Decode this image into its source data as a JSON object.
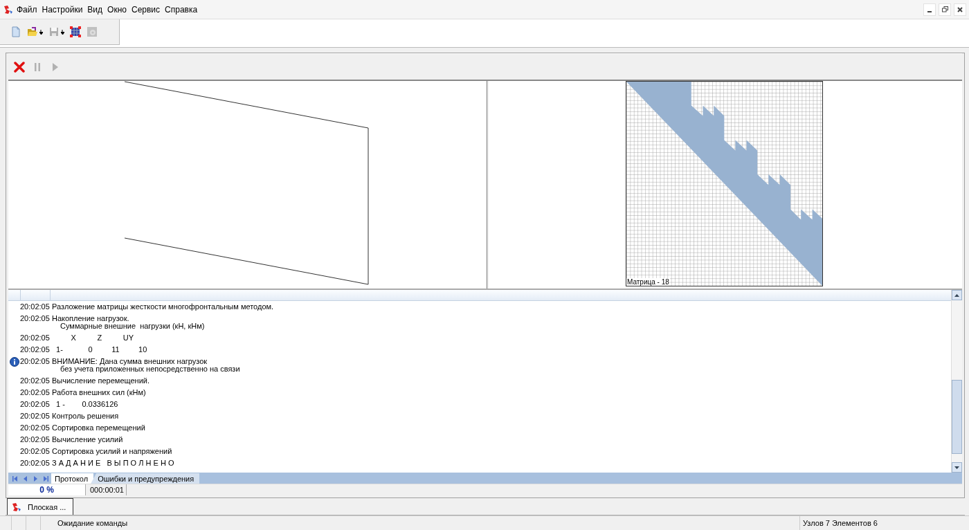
{
  "menu": [
    "Файл",
    "Настройки",
    "Вид",
    "Окно",
    "Сервис",
    "Справка"
  ],
  "toolbar": [
    {
      "kind": "new",
      "disabled": false,
      "dropdown": false
    },
    {
      "kind": "open",
      "disabled": false,
      "dropdown": true
    },
    {
      "kind": "save",
      "disabled": true,
      "dropdown": true
    },
    {
      "kind": "table",
      "disabled": false,
      "dropdown": false
    },
    {
      "kind": "settings",
      "disabled": true,
      "dropdown": false
    }
  ],
  "run_toolbar": [
    {
      "kind": "stop",
      "disabled": false
    },
    {
      "kind": "pause",
      "disabled": true
    },
    {
      "kind": "play",
      "disabled": true
    }
  ],
  "matrix": {
    "label": "Матрица - 18"
  },
  "log": [
    {
      "time": "20:02:05",
      "kind": "message",
      "text": "Разложение матрицы жесткости многофронтальным методом."
    },
    {
      "time": "20:02:05",
      "kind": "message",
      "text": "Накопление нагрузок.",
      "details": [
        "Суммарные внешние  нагрузки (кН, кНм)"
      ]
    },
    {
      "time": "20:02:05",
      "kind": "message",
      "text": "         X          Z          UY"
    },
    {
      "time": "20:02:05",
      "kind": "message",
      "text": "  1-            0         11         10"
    },
    {
      "time": "20:02:05",
      "kind": "info",
      "text": "ВНИМАНИЕ: Дана сумма внешних нагрузок",
      "details": [
        "без учета приложенных непосредственно на связи"
      ]
    },
    {
      "time": "20:02:05",
      "kind": "message",
      "text": "Вычисление перемещений."
    },
    {
      "time": "20:02:05",
      "kind": "message",
      "text": "Работа внешних сил (кНм)"
    },
    {
      "time": "20:02:05",
      "kind": "message",
      "text": "  1 -        0.0336126"
    },
    {
      "time": "20:02:05",
      "kind": "message",
      "text": "Контроль решения"
    },
    {
      "time": "20:02:05",
      "kind": "message",
      "text": "Сортировка перемещений"
    },
    {
      "time": "20:02:05",
      "kind": "message",
      "text": "Вычисление усилий"
    },
    {
      "time": "20:02:05",
      "kind": "message",
      "text": "Сортировка усилий и напряжений"
    },
    {
      "time": "20:02:05",
      "kind": "message",
      "text": "З А Д А Н И Е   В Ы П О Л Н Е Н О"
    }
  ],
  "log_tabs": [
    {
      "label": "Протокол",
      "selected": true
    },
    {
      "label": "Ошибки и предупреждения",
      "selected": false
    }
  ],
  "progress": {
    "percent": "0 %",
    "elapsed": "000:00:01"
  },
  "document_tabs": [
    {
      "label": "Плоская ...",
      "selected": true
    }
  ],
  "status_bar": {
    "message": "Ожидание команды",
    "counts": "Узлов 7 Элементов 6"
  }
}
